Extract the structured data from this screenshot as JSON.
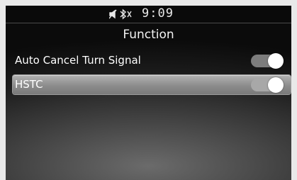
{
  "statusbar": {
    "icons": [
      "mute-icon",
      "bluetooth-icon"
    ],
    "time": "9:09"
  },
  "screen": {
    "title": "Function"
  },
  "settings": [
    {
      "label": "Auto Cancel Turn Signal",
      "enabled": true,
      "selected": false
    },
    {
      "label": "HSTC",
      "enabled": true,
      "selected": true
    }
  ],
  "colors": {
    "text": "#ffffff",
    "toggle_on_track": "#7d7d7d",
    "knob": "#ffffff",
    "highlight": "#a0a0a0"
  }
}
